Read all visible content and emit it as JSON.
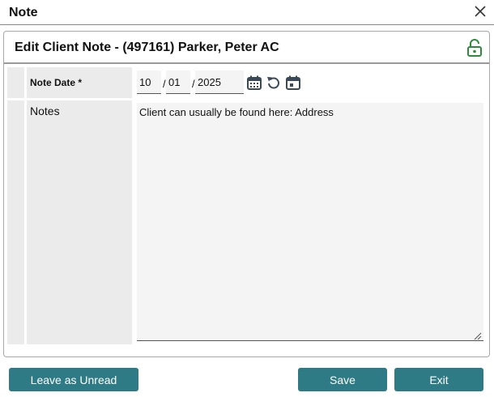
{
  "window": {
    "title": "Note"
  },
  "panel": {
    "heading": "Edit Client Note - (497161) Parker, Peter AC"
  },
  "form": {
    "note_date": {
      "label": "Note Date *",
      "month": "10",
      "day": "01",
      "year": "2025",
      "separator": "/"
    },
    "notes": {
      "label": "Notes",
      "value": "Client can usually be found here: Address"
    }
  },
  "buttons": {
    "leave_unread": "Leave as Unread",
    "save": "Save",
    "exit": "Exit"
  },
  "icons": [
    "close-icon",
    "unlock-icon",
    "calendar-icon",
    "reset-icon",
    "today-calendar-icon",
    "resize-handle-icon"
  ],
  "colors": {
    "accent": "#2f7b85",
    "lock": "#2e8b3a",
    "icon": "#3b4a59"
  }
}
